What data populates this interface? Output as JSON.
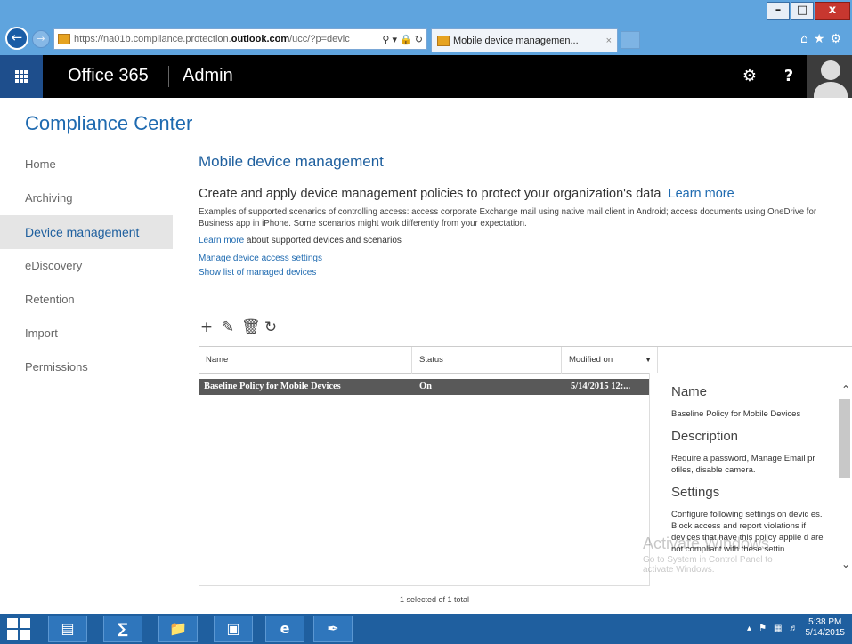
{
  "browser": {
    "url_prefix": "https://na01b.compliance.protection.",
    "url_domain": "outlook.com",
    "url_suffix": "/ucc/?p=devic",
    "tab_title": "Mobile device managemen...",
    "tab_close": "×",
    "window_buttons": {
      "minimize": "–",
      "maximize": "□",
      "close": "x"
    }
  },
  "o365": {
    "brand": "Office 365",
    "section": "Admin"
  },
  "app": {
    "title": "Compliance Center"
  },
  "sidebar": {
    "items": [
      {
        "label": "Home",
        "active": false
      },
      {
        "label": "Archiving",
        "active": false
      },
      {
        "label": "Device management",
        "active": true
      },
      {
        "label": "eDiscovery",
        "active": false
      },
      {
        "label": "Retention",
        "active": false
      },
      {
        "label": "Import",
        "active": false
      },
      {
        "label": "Permissions",
        "active": false
      }
    ]
  },
  "main": {
    "page_title": "Mobile device management",
    "lead_text": "Create and apply device management policies to protect your organization's data",
    "lead_link": "Learn more",
    "description": "Examples of supported scenarios of controlling access: access corporate Exchange mail using native mail client in Android; access documents using OneDrive for Business app in iPhone. Some scenarios might work differently from your expectation.",
    "supported_link": "Learn more",
    "supported_text": " about supported devices and scenarios",
    "manage_link": "Manage device access settings",
    "list_link": "Show list of managed devices"
  },
  "grid": {
    "columns": [
      "Name",
      "Status",
      "Modified on"
    ],
    "rows": [
      {
        "name": "Baseline Policy for Mobile Devices",
        "status": "On",
        "modified": "5/14/2015 12:..."
      }
    ],
    "footer": "1 selected of 1 total"
  },
  "details": {
    "name_heading": "Name",
    "name_value": "Baseline Policy for Mobile Devices",
    "desc_heading": "Description",
    "desc_value": "Require a password, Manage Email pr ofiles, disable camera.",
    "settings_heading": "Settings",
    "settings_value": "Configure following settings on devic es. Block access and report violations if devices that have this policy applie d are not compliant with these settin"
  },
  "watermark": {
    "line1": "Activate Windows",
    "line2": "Go to System in Control Panel to",
    "line3": "activate Windows."
  },
  "taskbar": {
    "time": "5:38 PM",
    "date": "5/14/2015"
  },
  "colors": {
    "accent": "#1e6ab0",
    "header_bg": "#000000",
    "waffle_bg": "#1e4e8c",
    "selected_row": "#595959",
    "taskbar": "#1f5f9f"
  }
}
